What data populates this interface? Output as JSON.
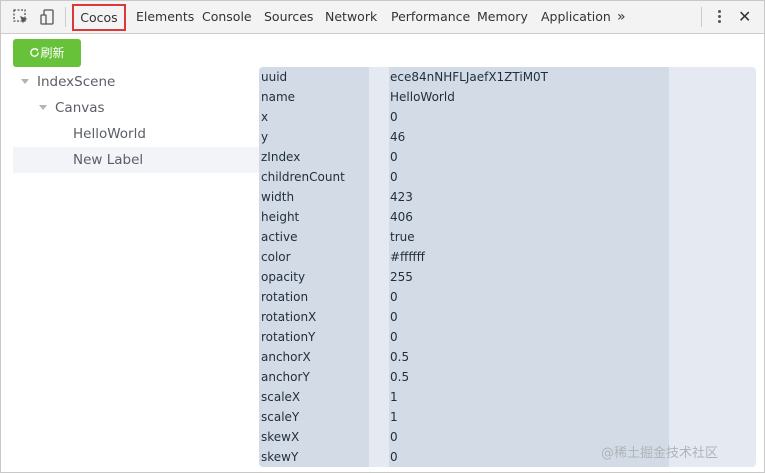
{
  "toolbar": {
    "tabs": [
      {
        "label": "Cocos",
        "active": true
      },
      {
        "label": "Elements"
      },
      {
        "label": "Console"
      },
      {
        "label": "Sources"
      },
      {
        "label": "Network"
      },
      {
        "label": "Performance"
      },
      {
        "label": "Memory"
      },
      {
        "label": "Application"
      }
    ],
    "more_label": "»",
    "close_label": "✕",
    "icons": [
      "inspect-icon",
      "device-toggle-icon",
      "kebab-menu-icon",
      "close-icon"
    ]
  },
  "refresh_button": {
    "icon": "refresh-icon",
    "label": "刷新"
  },
  "tree": {
    "nodes": [
      {
        "label": "IndexScene",
        "level": 1,
        "expanded": true
      },
      {
        "label": "Canvas",
        "level": 2,
        "expanded": true
      },
      {
        "label": "HelloWorld",
        "level": 3
      },
      {
        "label": "New Label",
        "level": 3,
        "selected": true
      }
    ]
  },
  "properties": [
    {
      "key": "uuid",
      "value": "ece84nNHFLJaefX1ZTiM0T"
    },
    {
      "key": "name",
      "value": "HelloWorld"
    },
    {
      "key": "x",
      "value": "0"
    },
    {
      "key": "y",
      "value": "46"
    },
    {
      "key": "zIndex",
      "value": "0"
    },
    {
      "key": "childrenCount",
      "value": "0"
    },
    {
      "key": "width",
      "value": "423"
    },
    {
      "key": "height",
      "value": "406"
    },
    {
      "key": "active",
      "value": "true"
    },
    {
      "key": "color",
      "value": "#ffffff"
    },
    {
      "key": "opacity",
      "value": "255"
    },
    {
      "key": "rotation",
      "value": "0"
    },
    {
      "key": "rotationX",
      "value": "0"
    },
    {
      "key": "rotationY",
      "value": "0"
    },
    {
      "key": "anchorX",
      "value": "0.5"
    },
    {
      "key": "anchorY",
      "value": "0.5"
    },
    {
      "key": "scaleX",
      "value": "1"
    },
    {
      "key": "scaleY",
      "value": "1"
    },
    {
      "key": "skewX",
      "value": "0"
    },
    {
      "key": "skewY",
      "value": "0"
    }
  ],
  "watermark": "@稀土掘金技术社区",
  "colors": {
    "refresh_green": "#67c23a",
    "tab_highlight": "#d9393a",
    "panel_bg": "#e5e9f2",
    "column_bg": "#d3dce6"
  }
}
